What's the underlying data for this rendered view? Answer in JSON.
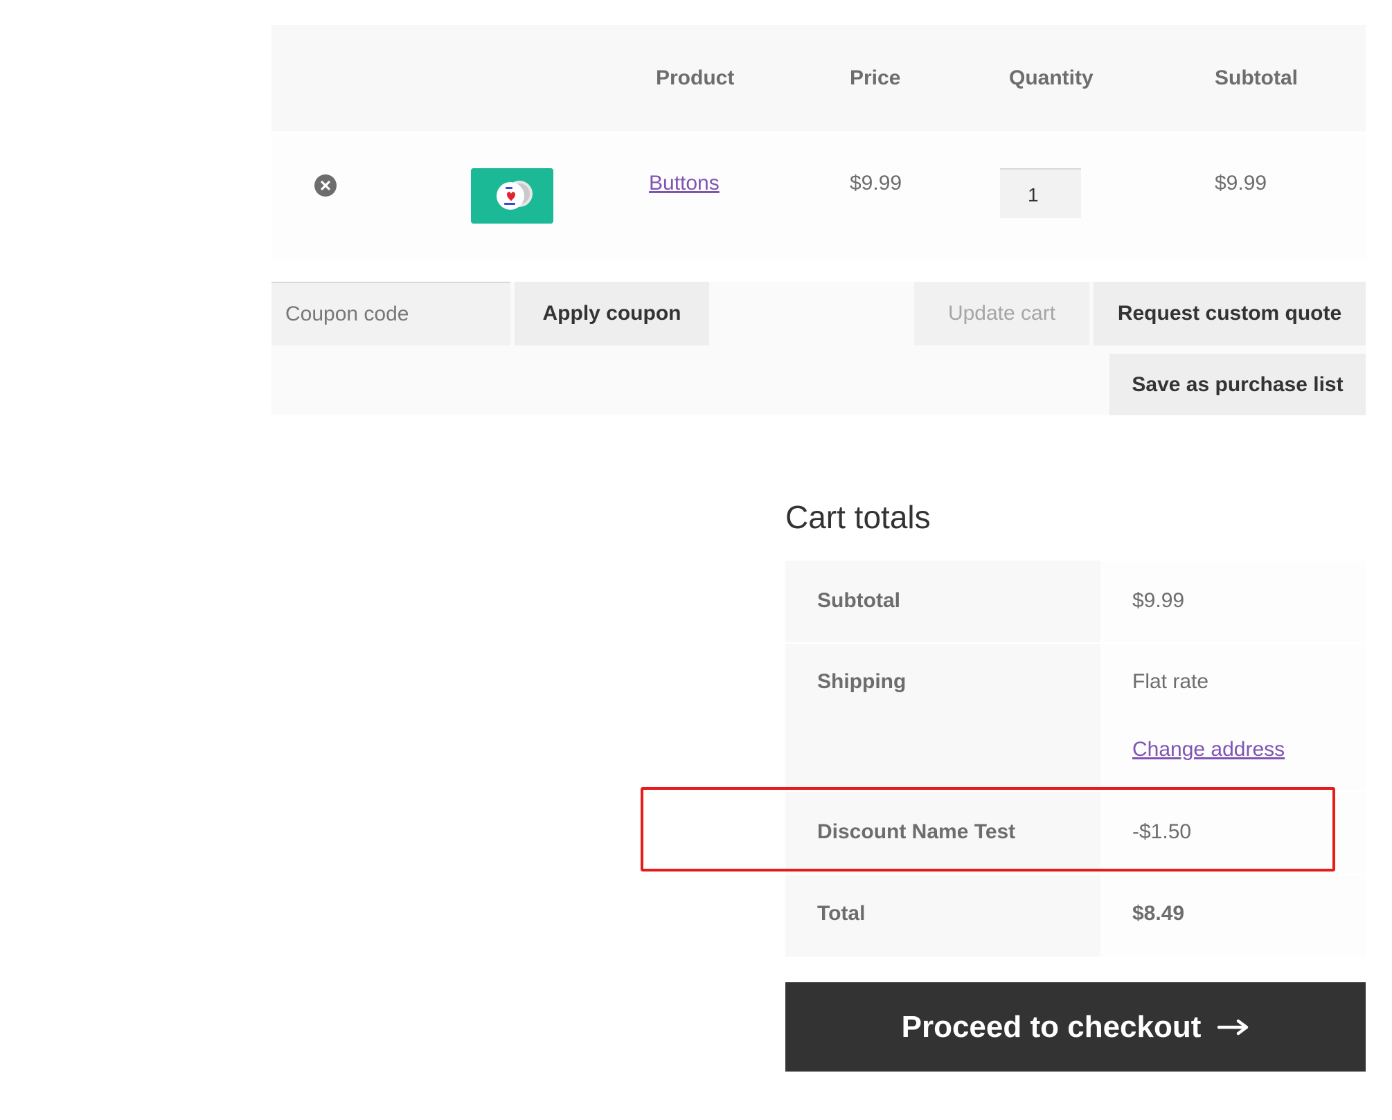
{
  "cart_table": {
    "headers": {
      "product": "Product",
      "price": "Price",
      "quantity": "Quantity",
      "subtotal": "Subtotal"
    },
    "items": [
      {
        "product_name": "Buttons",
        "price": "$9.99",
        "quantity": "1",
        "subtotal": "$9.99",
        "thumbnail_color": "#1bb996"
      }
    ]
  },
  "actions": {
    "coupon_placeholder": "Coupon code",
    "apply_coupon_label": "Apply coupon",
    "update_cart_label": "Update cart",
    "request_quote_label": "Request custom quote",
    "save_purchase_list_label": "Save as purchase list"
  },
  "cart_totals": {
    "title": "Cart totals",
    "subtotal_label": "Subtotal",
    "subtotal_value": "$9.99",
    "shipping_label": "Shipping",
    "shipping_method": "Flat rate",
    "change_address_label": "Change address",
    "discount_label": "Discount Name Test",
    "discount_value": "-$1.50",
    "total_label": "Total",
    "total_value": "$8.49"
  },
  "checkout": {
    "label": "Proceed to checkout"
  },
  "icons": {
    "remove": "remove-circle-icon",
    "checkout_arrow": "arrow-right-icon"
  },
  "colors": {
    "link": "#7f54b3",
    "checkout_bg": "#333333",
    "highlight": "#e81b1b"
  }
}
